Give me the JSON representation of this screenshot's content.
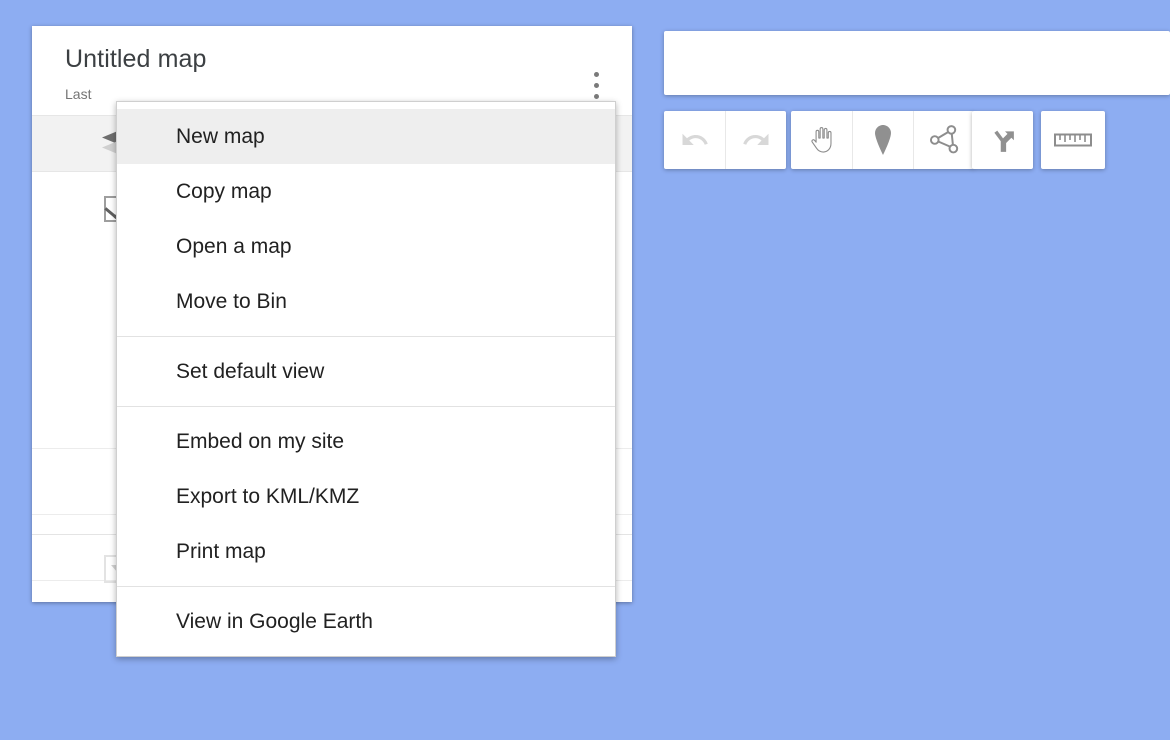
{
  "app": {
    "background_color": "#8dadf2"
  },
  "panel": {
    "title": "Untitled map",
    "subtitle": "Last",
    "kebab_name": "more-options",
    "layers_icon": "layers-icon",
    "layer_checkbox_checked": true,
    "style_strip_color": "#f5bb33",
    "collapse_icon": "caret-down-icon"
  },
  "menu": {
    "groups": [
      {
        "items": [
          {
            "label": "New map",
            "highlighted": true
          },
          {
            "label": "Copy map",
            "highlighted": false
          },
          {
            "label": "Open a map",
            "highlighted": false
          },
          {
            "label": "Move to Bin",
            "highlighted": false
          }
        ]
      },
      {
        "items": [
          {
            "label": "Set default view",
            "highlighted": false
          }
        ]
      },
      {
        "items": [
          {
            "label": "Embed on my site",
            "highlighted": false
          },
          {
            "label": "Export to KML/KMZ",
            "highlighted": false
          },
          {
            "label": "Print map",
            "highlighted": false
          }
        ]
      },
      {
        "items": [
          {
            "label": "View in Google Earth",
            "highlighted": false
          }
        ]
      }
    ]
  },
  "search": {
    "value": "",
    "placeholder": ""
  },
  "toolbar": {
    "groups": [
      {
        "name": "history",
        "buttons": [
          {
            "icon": "undo-icon",
            "label": "Undo",
            "disabled": true
          },
          {
            "icon": "redo-icon",
            "label": "Redo",
            "disabled": true
          }
        ]
      },
      {
        "name": "draw",
        "buttons": [
          {
            "icon": "hand-icon",
            "label": "Select items",
            "disabled": false
          },
          {
            "icon": "marker-icon",
            "label": "Add marker",
            "disabled": false
          },
          {
            "icon": "line-icon",
            "label": "Draw a line",
            "disabled": false
          }
        ]
      },
      {
        "name": "directions",
        "buttons": [
          {
            "icon": "directions-icon",
            "label": "Add directions",
            "disabled": false
          }
        ]
      },
      {
        "name": "measure",
        "buttons": [
          {
            "icon": "ruler-icon",
            "label": "Measure distances and areas",
            "disabled": false
          }
        ]
      }
    ]
  }
}
